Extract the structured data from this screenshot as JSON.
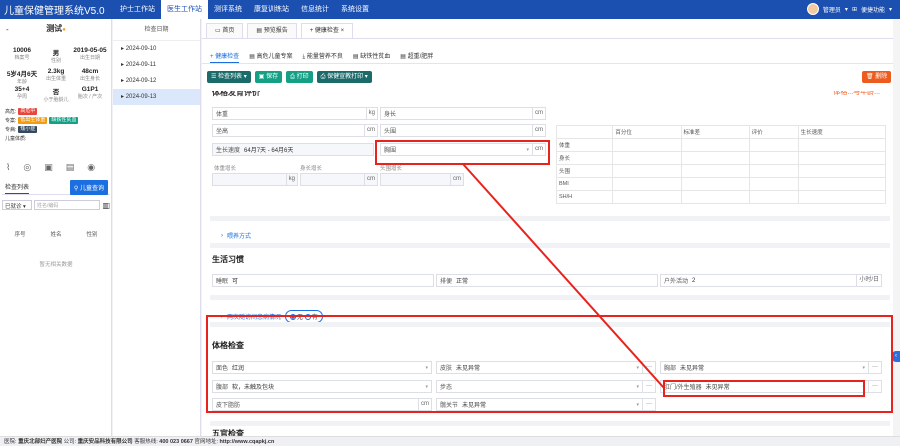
{
  "app_title": "儿童保健管理系统V5.0",
  "top_nav": [
    "护士工作站",
    "医生工作站",
    "测评系统",
    "康复训练站",
    "信息统计",
    "系统设置"
  ],
  "top_nav_active": 1,
  "user": {
    "name": "管理员",
    "menu": "便捷功能"
  },
  "patient": {
    "dash": "-",
    "name": "测试",
    "stats": [
      {
        "v": "10006",
        "l": "档案号"
      },
      {
        "v": "男",
        "l": "性别"
      },
      {
        "v": "2019-05-05",
        "l": "出生日期"
      },
      {
        "v": "5岁4月6天",
        "l": "年龄"
      },
      {
        "v": "2.3kg",
        "l": "出生体重"
      },
      {
        "v": "48cm",
        "l": "出生身长"
      },
      {
        "v": "35+4",
        "l": "孕周"
      },
      {
        "v": "否",
        "l": "小于胎龄儿"
      },
      {
        "v": "G1P1",
        "l": "胎次 / 产次"
      }
    ],
    "tags": [
      {
        "label": "高危:",
        "items": [
          {
            "t": "高危中",
            "c": "#e8453c"
          }
        ]
      },
      {
        "label": "专案:",
        "items": [
          {
            "t": "低出生体重",
            "c": "#f39c12"
          },
          {
            "t": "缺铁性贫血",
            "c": "#13a085"
          }
        ]
      },
      {
        "label": "专病:",
        "items": [
          {
            "t": "矮小症",
            "c": "#34495e"
          }
        ]
      }
    ],
    "physique_label": "儿童体质:"
  },
  "left_panel": {
    "list_tab": "检查列表",
    "query_button": "儿童查询",
    "filter_select": "已就诊",
    "search_placeholder": "姓名/编码",
    "columns": [
      "序号",
      "姓名",
      "性别"
    ],
    "empty_text": "暂无相关数据"
  },
  "date_column": {
    "header": "检查日期",
    "dates": [
      "2024-09-10",
      "2024-09-11",
      "2024-09-12",
      "2024-09-13"
    ],
    "active": 3
  },
  "tabs": [
    "首页",
    "预览报告",
    "健康检查"
  ],
  "subtabs": [
    "健康检查",
    "高危儿童专案",
    "能量营养不良",
    "缺铁性贫血",
    "超重/肥胖"
  ],
  "toolbar": {
    "list": "检查列表",
    "save": "保存",
    "print": "打印",
    "print_form": "保健宣教打印",
    "delete": "删除"
  },
  "growth": {
    "cut_title": "体格发育评价",
    "cut_right": "体格...与年龄...",
    "weight": "体重",
    "height": "身长",
    "sitting": "坐高",
    "head": "头围",
    "chest": "胸围",
    "speed_label": "生长速度",
    "speed_value": "64月7天 - 64月6天",
    "waist": "腰围",
    "incr_weight": "体重增长",
    "incr_height": "身长增长",
    "incr_head": "头围增长",
    "units": {
      "kg": "kg",
      "cm": "cm"
    },
    "table_headers": [
      "百分位",
      "标准差",
      "评价",
      "生长速度"
    ],
    "table_rows": [
      "体重",
      "身长",
      "头围",
      "BMI",
      "SH/H"
    ]
  },
  "feeding": "喂养方式",
  "lifestyle": {
    "title": "生活习惯",
    "appetite_label": "睡眠",
    "appetite_value": "可",
    "defecation_label": "排便",
    "defecation_value": "正常",
    "outdoor_label": "户外活动",
    "outdoor_value": "2",
    "outdoor_unit": "小时/日"
  },
  "followup": {
    "label": "两次随访间患病情况",
    "yes": "无",
    "no": "有"
  },
  "physical": {
    "title": "体格检查",
    "complexion_label": "面色",
    "complexion_value": "红润",
    "skin_label": "皮肤",
    "skin_value": "未见异常",
    "chest_label": "胸部",
    "chest_value": "未见异常",
    "abdomen_label": "腹部",
    "abdomen_value": "软，未触及包块",
    "gait_label": "步态",
    "gait_value": "",
    "genital_label": "肛门/外生殖器",
    "genital_value": "未见异常",
    "fat_label": "皮下脂肪",
    "fat_unit": "cm",
    "joint_label": "髋关节",
    "joint_value": "未见异常",
    "dots": "···"
  },
  "five_organs": "五官检查",
  "footer": {
    "hospital_label": "医院:",
    "hospital": "重庆北部妇产医院",
    "company_label": "公司:",
    "company": "重庆安品科技有限公司",
    "hotline_label": "客服热线:",
    "hotline": "400 023 0667",
    "site_label": "官网地址:",
    "site": "http://www.cqapkj.cn"
  },
  "annotation_color": "#e8231d"
}
